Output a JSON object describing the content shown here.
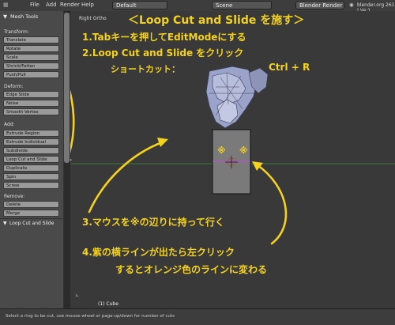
{
  "topbar": {
    "menu": [
      "File",
      "Add",
      "Render",
      "Help"
    ],
    "layout": "Default",
    "scene": "Scene",
    "engine": "Blender Render",
    "info": "blender.org 261 | Ve:1"
  },
  "toolpanel": {
    "title": "Mesh Tools",
    "sections": {
      "transform": "Transform:",
      "deform": "Deform:",
      "add": "Add:",
      "remove": "Remove:"
    },
    "buttons": {
      "translate": "Translate",
      "rotate": "Rotate",
      "scale": "Scale",
      "shrink": "Shrink/Fatten",
      "pushpull": "Push/Pull",
      "edgeslide": "Edge Slide",
      "noise": "Noise",
      "smooth": "Smooth Vertex",
      "extrude_region": "Extrude Region",
      "extrude_individual": "Extrude Individual",
      "subdivide": "Subdivide",
      "loopcut": "Loop Cut and Slide",
      "duplicate": "Duplicate",
      "spin": "Spin",
      "screw": "Screw",
      "delete": "Delete",
      "merge": "Merge"
    },
    "operator_panel": "Loop Cut and Slide"
  },
  "viewport": {
    "view_label": "Right Ortho",
    "object_label": "(1) Cube",
    "marker_glyph": "※"
  },
  "annotations": {
    "title": "＜Loop Cut and Slide を施す＞",
    "step1": "1.Tabキーを押してEditModeにする",
    "step2": "2.Loop Cut and Slide をクリック",
    "shortcut_label": "ショートカット：",
    "shortcut_keys": "Ctrl + R",
    "step3": "3.マウスを※の辺りに持って行く",
    "step4_line1": "4.紫の横ラインが出たら左クリック",
    "step4_line2": "するとオレンジ色のラインに変わる"
  },
  "statusbar": {
    "hint": "Select a ring to be cut, use mouse-wheel or page-up/down for number of cuts"
  },
  "colors": {
    "annotation": "#f5d21e",
    "loop_line": "#c24be0",
    "axis_line": "#3b8f3b"
  }
}
